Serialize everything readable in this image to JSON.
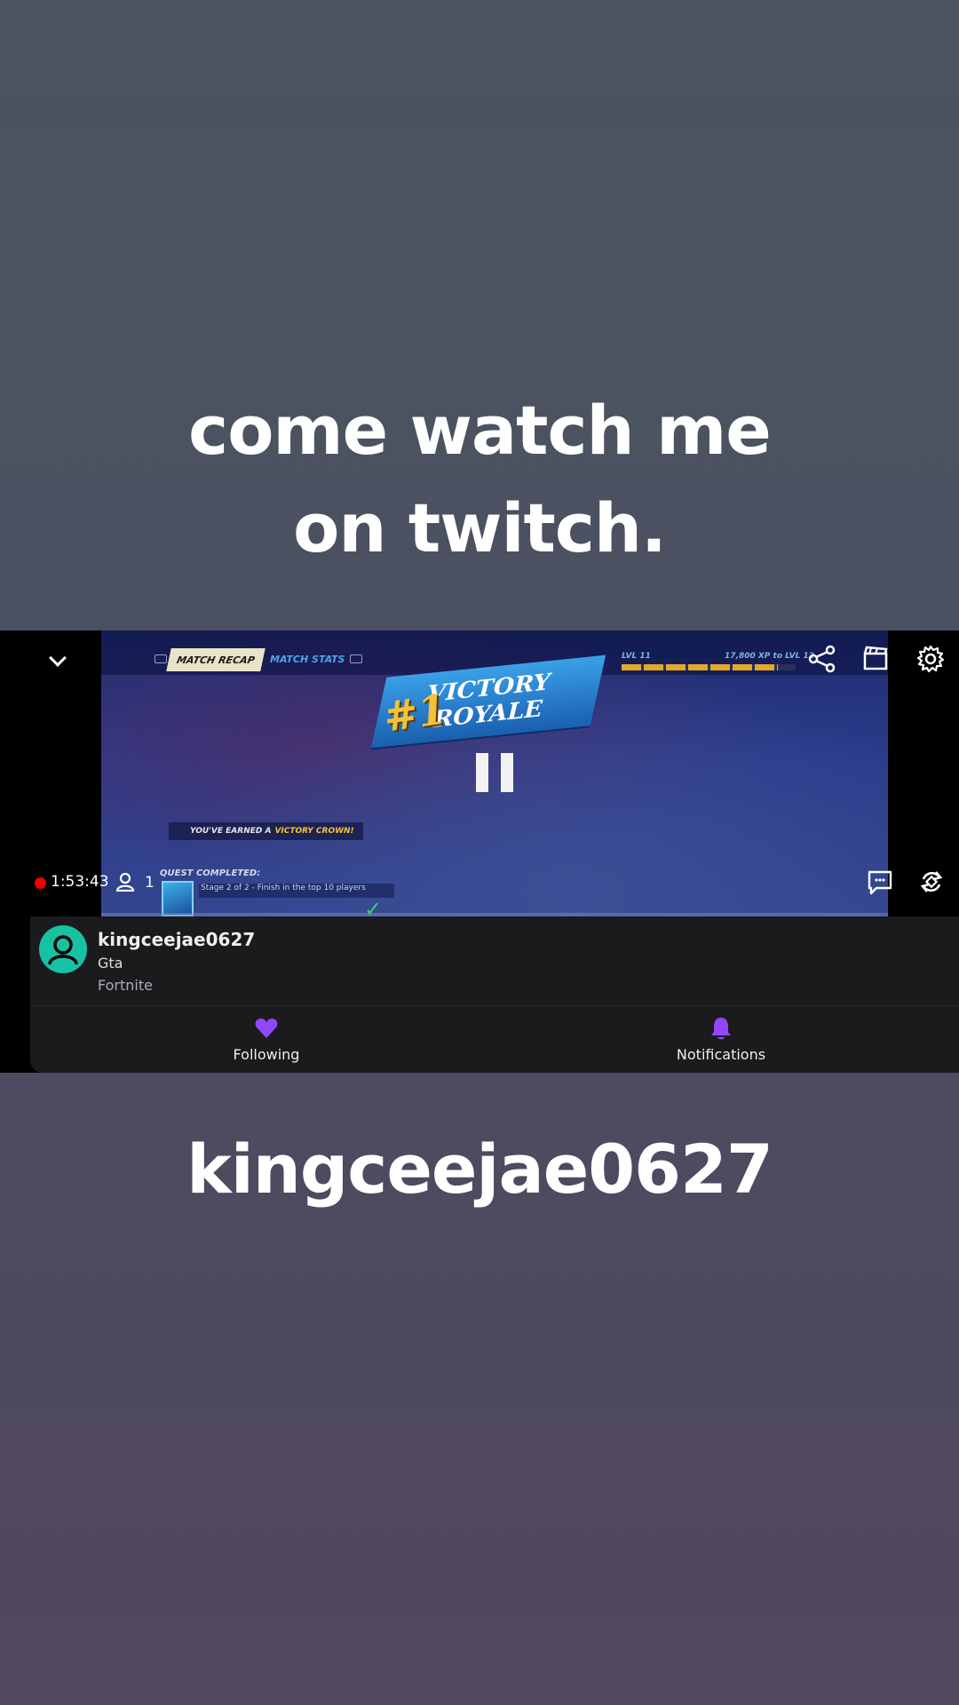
{
  "overlay": {
    "headline": "come watch me on twitch.",
    "channel_caption": "kingceejae0627"
  },
  "video": {
    "tabs": [
      "MATCH RECAP",
      "MATCH STATS"
    ],
    "level_label": "LVL 11",
    "xp_label": "17,800 XP to LVL 12",
    "victory_number": "#1",
    "victory_text": "VICTORY ROYALE",
    "crown_message": "YOU'VE EARNED A",
    "crown_highlight": "VICTORY CROWN!",
    "quest_title": "QUEST COMPLETED:",
    "quest_desc": "Stage 2 of 2 - Finish in the top 10 players",
    "xp_progress": 0.9
  },
  "player": {
    "live_time": "1:53:43",
    "viewer_count": "1",
    "live_color": "#eb0400"
  },
  "channel": {
    "name": "kingceejae0627",
    "title": "Gta",
    "game": "Fortnite",
    "avatar_color": "#19c1a3"
  },
  "actions": {
    "following_label": "Following",
    "notifications_label": "Notifications",
    "accent": "#9147ff"
  },
  "icons": [
    "chevron-down-icon",
    "share-icon",
    "clip-icon",
    "gear-icon",
    "viewer-icon",
    "chat-icon",
    "rotate-icon",
    "heart-icon",
    "bell-icon",
    "avatar-icon"
  ]
}
